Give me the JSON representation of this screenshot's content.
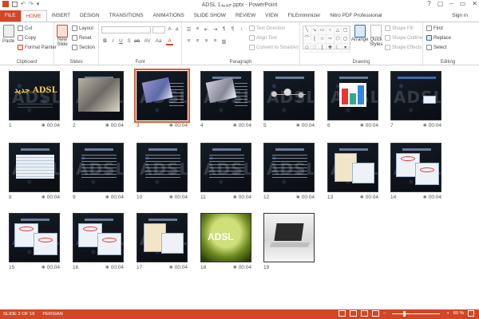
{
  "window": {
    "title": "ADSL جدید1.pptx - PowerPoint",
    "controls": [
      "?",
      "▢",
      "–",
      "▭",
      "✕"
    ]
  },
  "quick_access": {
    "undo": "↶",
    "redo": "↷",
    "more": "▾"
  },
  "tabs": [
    {
      "label": "FILE",
      "kind": "file"
    },
    {
      "label": "HOME",
      "kind": "active"
    },
    {
      "label": "INSERT"
    },
    {
      "label": "DESIGN"
    },
    {
      "label": "TRANSITIONS"
    },
    {
      "label": "ANIMATIONS"
    },
    {
      "label": "SLIDE SHOW"
    },
    {
      "label": "REVIEW"
    },
    {
      "label": "VIEW"
    },
    {
      "label": "FILEminimizer"
    },
    {
      "label": "Nitro PDF Professional"
    }
  ],
  "account": {
    "signin": "Sign in"
  },
  "ribbon": {
    "clipboard": {
      "label": "Clipboard",
      "paste": "Paste",
      "cut": "Cut",
      "copy": "Copy",
      "format_painter": "Format Painter"
    },
    "slides": {
      "label": "Slides",
      "new_slide": "New",
      "new_slide2": "Slide",
      "layout": "Layout",
      "reset": "Reset",
      "section": "Section"
    },
    "font": {
      "label": "Font"
    },
    "paragraph": {
      "label": "Paragraph",
      "text_direction": "Text Direction",
      "align_text": "Align Text",
      "convert": "Convert to SmartArt"
    },
    "drawing": {
      "label": "Drawing",
      "arrange": "Arrange",
      "quick_styles": "Quick",
      "quick_styles2": "Styles",
      "shape_fill": "Shape Fill",
      "shape_outline": "Shape Outline",
      "shape_effects": "Shape Effects"
    },
    "editing": {
      "label": "Editing",
      "find": "Find",
      "replace": "Replace",
      "select": "Select"
    }
  },
  "slides": [
    {
      "num": "1",
      "duration": "00:04",
      "kind": "title"
    },
    {
      "num": "2",
      "duration": "00:04",
      "kind": "room"
    },
    {
      "num": "3",
      "duration": "00:04",
      "kind": "photo",
      "selected": true
    },
    {
      "num": "4",
      "duration": "00:04",
      "kind": "photo2"
    },
    {
      "num": "5",
      "duration": "00:04",
      "kind": "net"
    },
    {
      "num": "6",
      "duration": "00:04",
      "kind": "chart"
    },
    {
      "num": "7",
      "duration": "00:04",
      "kind": "wm-device"
    },
    {
      "num": "8",
      "duration": "00:04",
      "kind": "table"
    },
    {
      "num": "9",
      "duration": "00:04",
      "kind": "text"
    },
    {
      "num": "10",
      "duration": "00:04",
      "kind": "text"
    },
    {
      "num": "11",
      "duration": "00:04",
      "kind": "text"
    },
    {
      "num": "12",
      "duration": "00:04",
      "kind": "text"
    },
    {
      "num": "13",
      "duration": "00:04",
      "kind": "screen"
    },
    {
      "num": "14",
      "duration": "00:04",
      "kind": "screen-red"
    },
    {
      "num": "15",
      "duration": "00:04",
      "kind": "screen-red"
    },
    {
      "num": "16",
      "duration": "00:04",
      "kind": "screen-red"
    },
    {
      "num": "17",
      "duration": "00:04",
      "kind": "screen"
    },
    {
      "num": "18",
      "duration": "00:04",
      "kind": "green"
    },
    {
      "num": "19",
      "duration": "",
      "kind": "laptop"
    }
  ],
  "status": {
    "slide": "SLIDE 3 OF 19",
    "language": "PERSIAN",
    "zoom": "60 %",
    "zoom_minus": "–",
    "zoom_plus": "+"
  },
  "colors": {
    "accent": "#d24726",
    "selected_outline": "#e05a2a"
  }
}
